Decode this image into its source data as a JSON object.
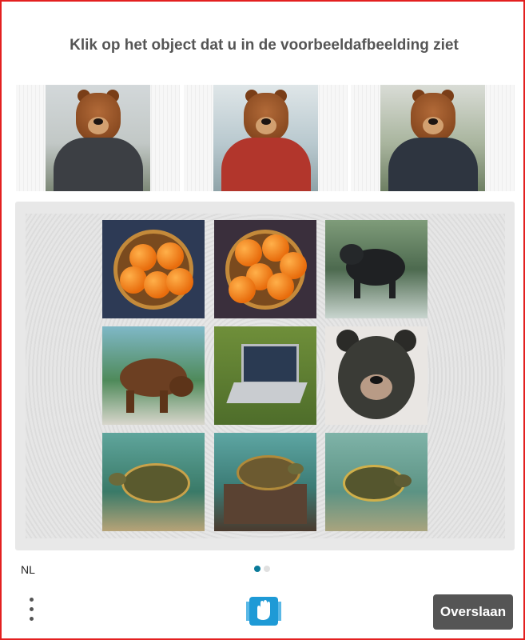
{
  "prompt": {
    "text": "Klik op het object dat u in de voorbeeldafbeelding ziet"
  },
  "examples": [
    {
      "name": "bear-gray-jacket-example",
      "jacket_color": "#3c3f44"
    },
    {
      "name": "bear-red-jacket-example",
      "jacket_color": "#b2362c"
    },
    {
      "name": "bear-dark-jacket-example",
      "jacket_color": "#2e3540"
    }
  ],
  "tiles": [
    {
      "name": "tile-oranges-bowl-1",
      "kind": "oranges"
    },
    {
      "name": "tile-oranges-bowl-2",
      "kind": "oranges"
    },
    {
      "name": "tile-black-bear-forest",
      "kind": "bear-walk-dark"
    },
    {
      "name": "tile-brown-bear-forest",
      "kind": "bear-walk-brown"
    },
    {
      "name": "tile-laptop-grass",
      "kind": "laptop"
    },
    {
      "name": "tile-bear-face-drawing",
      "kind": "bear-face"
    },
    {
      "name": "tile-turtle-1",
      "kind": "turtle"
    },
    {
      "name": "tile-turtle-2",
      "kind": "turtle-rock"
    },
    {
      "name": "tile-turtle-3",
      "kind": "turtle"
    }
  ],
  "footer": {
    "language": "NL",
    "skip_label": "Overslaan",
    "menu_icon": "three-dots-vertical-icon",
    "logo_icon": "hand-logo-icon"
  },
  "pagination": {
    "current": 1,
    "total": 2
  },
  "colors": {
    "frame_border": "#e32020",
    "skip_button": "#555555",
    "dot_active": "#0a7a99",
    "dot_inactive": "#e0e0e0",
    "logo_blue": "#1e9ad6"
  }
}
